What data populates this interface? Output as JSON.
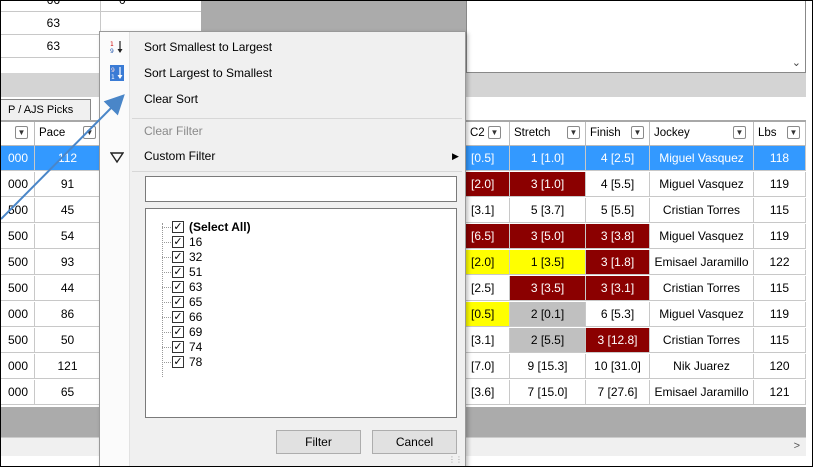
{
  "top_rows": [
    {
      "left": "66",
      "right": "0"
    },
    {
      "left": "63",
      "right": ""
    },
    {
      "left": "63",
      "right": ""
    }
  ],
  "tab_label": "P / AJS Picks",
  "grid": {
    "headers": {
      "c0": "",
      "pace": "Pace",
      "c2": "C2",
      "stretch": "Stretch",
      "finish": "Finish",
      "jockey": "Jockey",
      "lbs": "Lbs"
    },
    "rows": [
      {
        "c0": "000",
        "pace": "112",
        "c2": "[0.5]",
        "stretch": "1 [1.0]",
        "finish": "4 [2.5]",
        "jockey": "Miguel Vasquez",
        "lbs": "118",
        "selected": true
      },
      {
        "c0": "000",
        "pace": "91",
        "c2": "[2.0]",
        "stretch": "3 [1.0]",
        "finish": "4 [5.5]",
        "jockey": "Miguel Vasquez",
        "lbs": "119"
      },
      {
        "c0": "500",
        "pace": "45",
        "c2": "[3.1]",
        "stretch": "5 [3.7]",
        "finish": "5 [5.5]",
        "jockey": "Cristian Torres",
        "lbs": "115"
      },
      {
        "c0": "500",
        "pace": "54",
        "c2": "[6.5]",
        "stretch": "3 [5.0]",
        "finish": "3 [3.8]",
        "jockey": "Miguel Vasquez",
        "lbs": "119"
      },
      {
        "c0": "500",
        "pace": "93",
        "c2": "[2.0]",
        "stretch": "1 [3.5]",
        "finish": "3 [1.8]",
        "jockey": "Emisael Jaramillo",
        "lbs": "122"
      },
      {
        "c0": "500",
        "pace": "44",
        "c2": "[2.5]",
        "stretch": "3 [3.5]",
        "finish": "3 [3.1]",
        "jockey": "Cristian Torres",
        "lbs": "115"
      },
      {
        "c0": "000",
        "pace": "86",
        "c2": "[0.5]",
        "stretch": "2 [0.1]",
        "finish": "6 [5.3]",
        "jockey": "Miguel Vasquez",
        "lbs": "119"
      },
      {
        "c0": "500",
        "pace": "50",
        "c2": "[3.1]",
        "stretch": "2 [5.5]",
        "finish": "3 [12.8]",
        "jockey": "Cristian Torres",
        "lbs": "115"
      },
      {
        "c0": "000",
        "pace": "121",
        "c2": "[7.0]",
        "stretch": "9 [15.3]",
        "finish": "10 [31.0]",
        "jockey": "Nik Juarez",
        "lbs": "120"
      },
      {
        "c0": "000",
        "pace": "65",
        "c2": "[3.6]",
        "stretch": "7 [15.0]",
        "finish": "7 [27.6]",
        "jockey": "Emisael Jaramillo",
        "lbs": "121"
      }
    ]
  },
  "cell_colors": {
    "selected": "#3399ff",
    "dark_red": "#8b0000",
    "yellow": "#ffff00",
    "gray": "#c0c0c0"
  },
  "row_highlights": [
    {
      "c2": "selected",
      "stretch": "selected",
      "finish": "selected"
    },
    {
      "c2": "dark_red",
      "stretch": "dark_red"
    },
    {},
    {
      "c2": "dark_red",
      "stretch": "dark_red",
      "finish": "dark_red"
    },
    {
      "c2": "yellow",
      "stretch": "yellow",
      "finish": "dark_red"
    },
    {
      "stretch": "dark_red",
      "finish": "dark_red"
    },
    {
      "c2": "yellow",
      "stretch": "gray"
    },
    {
      "stretch": "gray",
      "finish": "dark_red"
    },
    {},
    {}
  ],
  "menu": {
    "sort_asc": "Sort Smallest to Largest",
    "sort_desc": "Sort Largest to Smallest",
    "clear_sort": "Clear Sort",
    "clear_filter": "Clear Filter",
    "custom_filter": "Custom Filter",
    "search_value": "",
    "values": [
      "(Select All)",
      "16",
      "32",
      "51",
      "63",
      "65",
      "66",
      "69",
      "74",
      "78"
    ],
    "filter_button": "Filter",
    "cancel_button": "Cancel"
  },
  "accent_color": "#4a86c8"
}
